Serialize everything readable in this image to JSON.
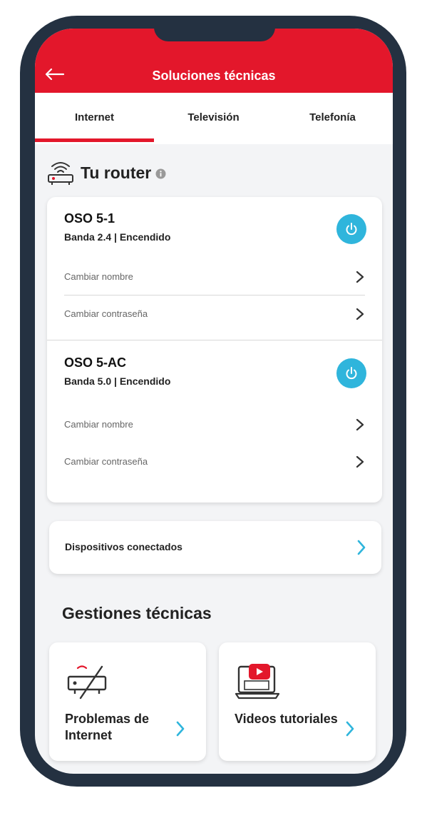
{
  "header": {
    "title": "Soluciones técnicas",
    "back_icon": "arrow-left-icon"
  },
  "tabs": [
    {
      "label": "Internet",
      "active": true
    },
    {
      "label": "Televisión",
      "active": false
    },
    {
      "label": "Telefonía",
      "active": false
    }
  ],
  "router_section": {
    "title": "Tu router",
    "icon": "router-wifi-icon",
    "info_icon": "info-icon"
  },
  "networks": [
    {
      "name": "OSO 5-1",
      "status": "Banda 2.4 | Encendido",
      "change_name": "Cambiar nombre",
      "change_password": "Cambiar contraseña"
    },
    {
      "name": "OSO 5-AC",
      "status": "Banda 5.0 | Encendido",
      "change_name": "Cambiar nombre",
      "change_password": "Cambiar contraseña"
    }
  ],
  "devices": {
    "label": "Dispositivos conectados"
  },
  "gestiones": {
    "title": "Gestiones técnicas",
    "tiles": [
      {
        "label": "Problemas de Internet",
        "icon": "router-off-icon"
      },
      {
        "label": "Videos tutoriales",
        "icon": "video-tutorial-icon"
      }
    ]
  },
  "colors": {
    "brand": "#e3172b",
    "accent": "#2fb5dc",
    "frame": "#243141"
  }
}
